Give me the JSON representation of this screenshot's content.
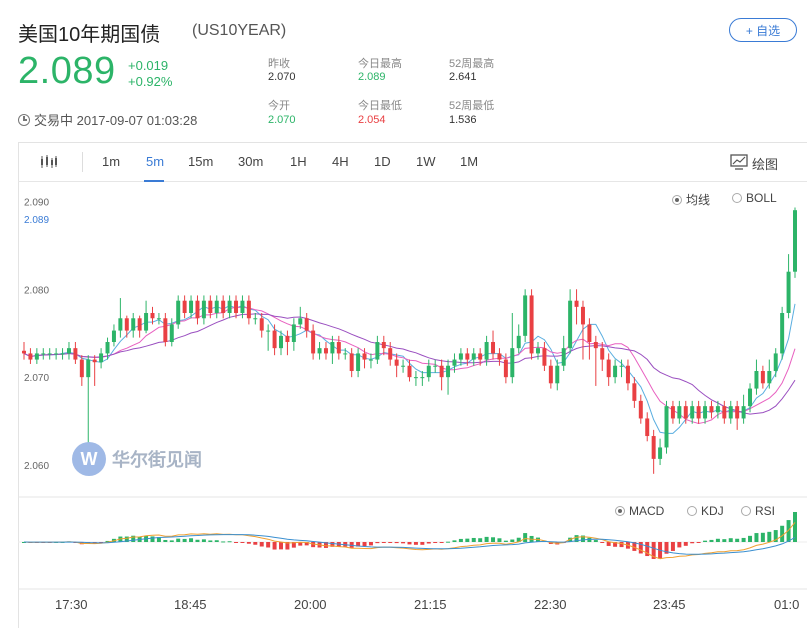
{
  "header": {
    "title": "美国10年期国债",
    "ticker": "(US10YEAR)",
    "add_button": "+ 自选"
  },
  "quote": {
    "price": "2.089",
    "change": "+0.019",
    "change_pct": "+0.92%",
    "status": "交易中 2017-09-07 01:03:28"
  },
  "stats": {
    "prev_close_label": "昨收",
    "prev_close": "2.070",
    "day_high_label": "今日最高",
    "day_high": "2.089",
    "wk52_high_label": "52周最高",
    "wk52_high": "2.641",
    "open_label": "今开",
    "open": "2.070",
    "day_low_label": "今日最低",
    "day_low": "2.054",
    "wk52_low_label": "52周最低",
    "wk52_low": "1.536"
  },
  "toolbar": {
    "intervals": [
      "1m",
      "5m",
      "15m",
      "30m",
      "1H",
      "4H",
      "1D",
      "1W",
      "1M"
    ],
    "active_interval": "5m",
    "draw_label": "绘图"
  },
  "main_panel": {
    "options": [
      {
        "label": "均线",
        "selected": true
      },
      {
        "label": "BOLL",
        "selected": false
      }
    ],
    "current_price_label": "2.089"
  },
  "sub_panel": {
    "options": [
      {
        "label": "MACD",
        "selected": true
      },
      {
        "label": "KDJ",
        "selected": false
      },
      {
        "label": "RSI",
        "selected": false
      }
    ]
  },
  "watermark": {
    "text": "华尔街见闻",
    "logo_letter": "W"
  },
  "colors": {
    "up": "#2cb468",
    "down": "#e94043",
    "accent": "#3a7bd5",
    "ma1": "#5aaee0",
    "ma2": "#e860c0",
    "ma3": "#9a4fc0",
    "dif": "#f0a030",
    "dea": "#3a8fd0"
  },
  "chart_data": {
    "type": "candlestick",
    "y_ticks": [
      "2.090",
      "2.080",
      "2.070",
      "2.060"
    ],
    "ylim": [
      2.0575,
      2.0905
    ],
    "x_ticks": [
      "17:30",
      "18:45",
      "20:00",
      "21:15",
      "22:30",
      "23:45",
      "01:0"
    ],
    "candles": [
      [
        2.073,
        2.0727,
        2.074,
        2.072
      ],
      [
        2.0727,
        2.072,
        2.0733,
        2.0715
      ],
      [
        2.072,
        2.0727,
        2.0733,
        2.0715
      ],
      [
        2.0727,
        2.0727,
        2.0733,
        2.072
      ],
      [
        2.0727,
        2.0727,
        2.0733,
        2.072
      ],
      [
        2.0727,
        2.0727,
        2.0733,
        2.072
      ],
      [
        2.0727,
        2.0727,
        2.0733,
        2.072
      ],
      [
        2.0727,
        2.0733,
        2.074,
        2.072
      ],
      [
        2.0733,
        2.072,
        2.074,
        2.0715
      ],
      [
        2.072,
        2.07,
        2.0725,
        2.069
      ],
      [
        2.07,
        2.072,
        2.0725,
        2.062
      ],
      [
        2.072,
        2.0717,
        2.0725,
        2.069
      ],
      [
        2.0717,
        2.0727,
        2.0733,
        2.071
      ],
      [
        2.0727,
        2.074,
        2.0745,
        2.072
      ],
      [
        2.074,
        2.0753,
        2.076,
        2.0735
      ],
      [
        2.0753,
        2.0767,
        2.079,
        2.0745
      ],
      [
        2.0767,
        2.0753,
        2.077,
        2.0745
      ],
      [
        2.0753,
        2.0767,
        2.0773,
        2.0745
      ],
      [
        2.0767,
        2.0753,
        2.077,
        2.0745
      ],
      [
        2.0753,
        2.0773,
        2.0787,
        2.075
      ],
      [
        2.0773,
        2.0767,
        2.078,
        2.076
      ],
      [
        2.0767,
        2.0767,
        2.0773,
        2.076
      ],
      [
        2.0767,
        2.074,
        2.0773,
        2.0735
      ],
      [
        2.074,
        2.076,
        2.0767,
        2.0735
      ],
      [
        2.076,
        2.0787,
        2.0793,
        2.0755
      ],
      [
        2.0787,
        2.0773,
        2.0793,
        2.0767
      ],
      [
        2.0773,
        2.0787,
        2.0793,
        2.0767
      ],
      [
        2.0787,
        2.0767,
        2.0793,
        2.076
      ],
      [
        2.0767,
        2.0787,
        2.0793,
        2.076
      ],
      [
        2.0787,
        2.0773,
        2.0793,
        2.0767
      ],
      [
        2.0773,
        2.0787,
        2.0793,
        2.0767
      ],
      [
        2.0787,
        2.0773,
        2.0793,
        2.0767
      ],
      [
        2.0773,
        2.0787,
        2.0793,
        2.0767
      ],
      [
        2.0787,
        2.0773,
        2.0793,
        2.0767
      ],
      [
        2.0773,
        2.0787,
        2.0793,
        2.0767
      ],
      [
        2.0787,
        2.0767,
        2.0793,
        2.076
      ],
      [
        2.0767,
        2.0767,
        2.0773,
        2.076
      ],
      [
        2.0767,
        2.0753,
        2.0773,
        2.0745
      ],
      [
        2.0753,
        2.0753,
        2.076,
        2.073
      ],
      [
        2.0753,
        2.0733,
        2.076,
        2.0725
      ],
      [
        2.0733,
        2.0747,
        2.0753,
        2.0725
      ],
      [
        2.0747,
        2.074,
        2.0753,
        2.0725
      ],
      [
        2.074,
        2.076,
        2.0767,
        2.073
      ],
      [
        2.076,
        2.0767,
        2.078,
        2.0755
      ],
      [
        2.0767,
        2.0753,
        2.0773,
        2.0745
      ],
      [
        2.0753,
        2.0727,
        2.076,
        2.072
      ],
      [
        2.0727,
        2.0733,
        2.074,
        2.072
      ],
      [
        2.0733,
        2.0727,
        2.074,
        2.072
      ],
      [
        2.0727,
        2.074,
        2.0747,
        2.0715
      ],
      [
        2.074,
        2.0727,
        2.0747,
        2.072
      ],
      [
        2.0727,
        2.0727,
        2.0733,
        2.072
      ],
      [
        2.0727,
        2.0707,
        2.0733,
        2.07
      ],
      [
        2.0707,
        2.0727,
        2.0733,
        2.07
      ],
      [
        2.0727,
        2.072,
        2.0733,
        2.071
      ],
      [
        2.072,
        2.072,
        2.0727,
        2.071
      ],
      [
        2.072,
        2.074,
        2.0747,
        2.0715
      ],
      [
        2.074,
        2.0733,
        2.0747,
        2.0725
      ],
      [
        2.0733,
        2.072,
        2.074,
        2.0713
      ],
      [
        2.072,
        2.0713,
        2.0727,
        2.07
      ],
      [
        2.0713,
        2.0713,
        2.072,
        2.0705
      ],
      [
        2.0713,
        2.07,
        2.072,
        2.0695
      ],
      [
        2.07,
        2.07,
        2.0707,
        2.069
      ],
      [
        2.07,
        2.07,
        2.0707,
        2.069
      ],
      [
        2.07,
        2.0713,
        2.072,
        2.0695
      ],
      [
        2.0713,
        2.0713,
        2.072,
        2.0705
      ],
      [
        2.0713,
        2.07,
        2.072,
        2.0685
      ],
      [
        2.07,
        2.0713,
        2.072,
        2.068
      ],
      [
        2.0713,
        2.072,
        2.0727,
        2.0705
      ],
      [
        2.072,
        2.0727,
        2.0733,
        2.0713
      ],
      [
        2.0727,
        2.072,
        2.0733,
        2.0713
      ],
      [
        2.072,
        2.0727,
        2.0733,
        2.0713
      ],
      [
        2.0727,
        2.072,
        2.0733,
        2.0713
      ],
      [
        2.072,
        2.074,
        2.0747,
        2.0713
      ],
      [
        2.074,
        2.0727,
        2.0753,
        2.072
      ],
      [
        2.0727,
        2.072,
        2.0733,
        2.0713
      ],
      [
        2.072,
        2.07,
        2.0727,
        2.0693
      ],
      [
        2.07,
        2.0733,
        2.0773,
        2.0693
      ],
      [
        2.0733,
        2.0747,
        2.076,
        2.0727
      ],
      [
        2.0747,
        2.0793,
        2.08,
        2.074
      ],
      [
        2.0793,
        2.0727,
        2.08,
        2.072
      ],
      [
        2.0727,
        2.0733,
        2.074,
        2.072
      ],
      [
        2.0733,
        2.0713,
        2.074,
        2.0707
      ],
      [
        2.0713,
        2.0693,
        2.072,
        2.0687
      ],
      [
        2.0693,
        2.0713,
        2.072,
        2.0685
      ],
      [
        2.0713,
        2.0733,
        2.0747,
        2.0707
      ],
      [
        2.0733,
        2.0787,
        2.08,
        2.0727
      ],
      [
        2.0787,
        2.078,
        2.08,
        2.076
      ],
      [
        2.078,
        2.076,
        2.0787,
        2.072
      ],
      [
        2.076,
        2.074,
        2.0767,
        2.072
      ],
      [
        2.074,
        2.0733,
        2.0747,
        2.069
      ],
      [
        2.0733,
        2.072,
        2.074,
        2.0707
      ],
      [
        2.072,
        2.07,
        2.0727,
        2.069
      ],
      [
        2.07,
        2.0713,
        2.072,
        2.0693
      ],
      [
        2.0713,
        2.0713,
        2.072,
        2.07
      ],
      [
        2.0713,
        2.0693,
        2.072,
        2.0685
      ],
      [
        2.0693,
        2.0673,
        2.07,
        2.0665
      ],
      [
        2.0673,
        2.0653,
        2.068,
        2.0647
      ],
      [
        2.0653,
        2.0633,
        2.066,
        2.0627
      ],
      [
        2.0633,
        2.0607,
        2.064,
        2.059
      ],
      [
        2.0607,
        2.062,
        2.063,
        2.06
      ],
      [
        2.062,
        2.0667,
        2.0673,
        2.0613
      ],
      [
        2.0667,
        2.0653,
        2.0673,
        2.0647
      ],
      [
        2.0653,
        2.0667,
        2.0673,
        2.0647
      ],
      [
        2.0667,
        2.0653,
        2.0673,
        2.0647
      ],
      [
        2.0653,
        2.0667,
        2.0673,
        2.0647
      ],
      [
        2.0667,
        2.0653,
        2.0673,
        2.0647
      ],
      [
        2.0653,
        2.0667,
        2.0673,
        2.0647
      ],
      [
        2.0667,
        2.066,
        2.0673,
        2.0653
      ],
      [
        2.066,
        2.0667,
        2.0673,
        2.0653
      ],
      [
        2.0667,
        2.0653,
        2.0673,
        2.0647
      ],
      [
        2.0653,
        2.0667,
        2.0673,
        2.0647
      ],
      [
        2.0667,
        2.0653,
        2.0673,
        2.064
      ],
      [
        2.0653,
        2.0667,
        2.068,
        2.0647
      ],
      [
        2.0667,
        2.0687,
        2.0693,
        2.066
      ],
      [
        2.0687,
        2.0707,
        2.072,
        2.068
      ],
      [
        2.0707,
        2.0693,
        2.0713,
        2.0687
      ],
      [
        2.0693,
        2.0707,
        2.072,
        2.0687
      ],
      [
        2.0707,
        2.0727,
        2.0733,
        2.07
      ],
      [
        2.0727,
        2.0773,
        2.078,
        2.072
      ],
      [
        2.0773,
        2.082,
        2.084,
        2.0767
      ],
      [
        2.082,
        2.089,
        2.0893,
        2.0813
      ]
    ]
  }
}
